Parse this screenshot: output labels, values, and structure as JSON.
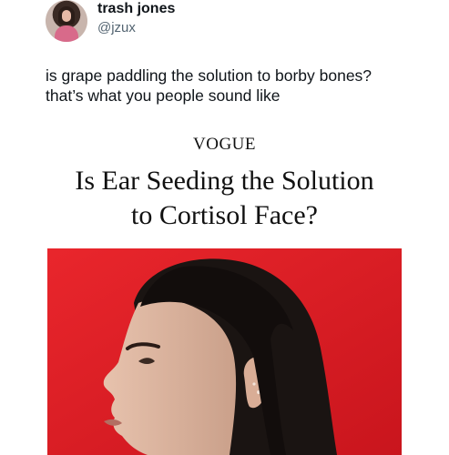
{
  "tweet": {
    "author_name": "trash jones",
    "author_handle": "@jzux",
    "text_lines": [
      "is grape paddling the solution to borby bones?",
      "that’s what you people sound like"
    ]
  },
  "article": {
    "publication": "VOGUE",
    "headline_lines": [
      "Is Ear Seeding the Solution",
      "to Cortisol Face?"
    ]
  },
  "colors": {
    "photo_background": "#e0222a",
    "text": "#0f1419",
    "handle": "#536471"
  },
  "icons": {
    "avatar": "profile-photo"
  }
}
